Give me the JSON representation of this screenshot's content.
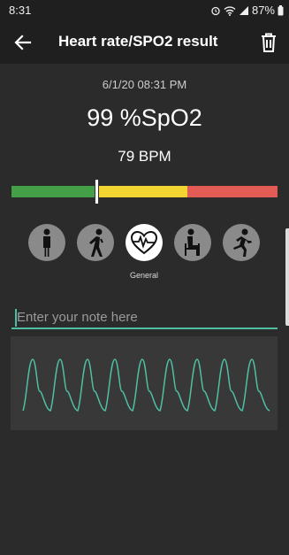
{
  "status_bar": {
    "time": "8:31",
    "battery": "87%"
  },
  "app_bar": {
    "title": "Heart rate/SPO2 result"
  },
  "result": {
    "datetime": "6/1/20 08:31 PM",
    "spo2": "99 %SpO2",
    "heart_rate": "79 BPM"
  },
  "level_bar": {
    "segments": [
      {
        "name": "green",
        "color": "#43a047",
        "fraction": 0.32
      },
      {
        "name": "yellow",
        "color": "#f2d531",
        "fraction": 0.34
      },
      {
        "name": "red",
        "color": "#e25b55",
        "fraction": 0.34
      }
    ],
    "marker_fraction": 0.32
  },
  "activities": {
    "items": [
      {
        "icon": "standing-person-icon"
      },
      {
        "icon": "bent-person-icon"
      },
      {
        "icon": "heart-pulse-icon",
        "label": "General",
        "selected": true
      },
      {
        "icon": "sitting-person-icon"
      },
      {
        "icon": "running-person-icon"
      }
    ]
  },
  "note": {
    "placeholder": "Enter your note here",
    "value": ""
  },
  "colors": {
    "accent": "#4fbfa3",
    "background": "#2b2b2b",
    "app_bar": "#1f1f1f"
  }
}
